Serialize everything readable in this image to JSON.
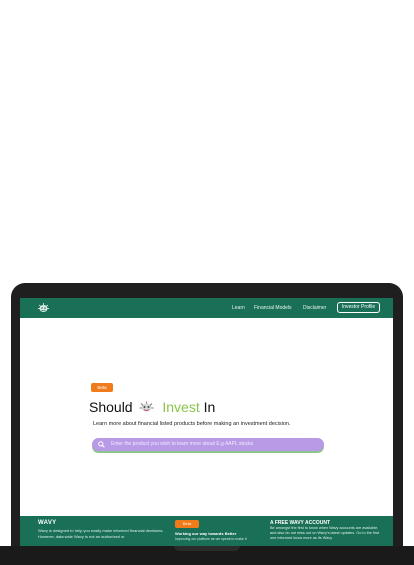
{
  "navbar": {
    "links": [
      "Learn",
      "Financial Models",
      "Disclaimer"
    ],
    "profile_button": "Investor Profile"
  },
  "hero": {
    "badge": "Beta",
    "title_prefix": "Should",
    "title_highlight": "Invest",
    "title_suffix": "In",
    "subtitle": "Learn more about financial listed products before making an investment decision."
  },
  "search": {
    "placeholder": "Enter the product you wish to learn more about E.g AAPL stocks"
  },
  "footer": {
    "brand": "WAVY",
    "description": "Wavy is designed to help you easily make informed financial decisions. However, data wide Wavy is not an authorized or",
    "badge": "Beta",
    "mid_title": "Working our way towards Better",
    "mid_text": "Improving our platform as we speak to make it",
    "right_title": "A FREE WAVY ACCOUNT",
    "right_text": "Be amongst the first to know when Wavy accounts are available, and also do not miss out on Wavy's latest updates. Go to the first one informed know more as its Wavy"
  },
  "colors": {
    "brand_green": "#1a6f57",
    "accent_orange": "#f07b1a",
    "highlight_green": "#8bc34a",
    "search_purple": "#b99ae6"
  }
}
